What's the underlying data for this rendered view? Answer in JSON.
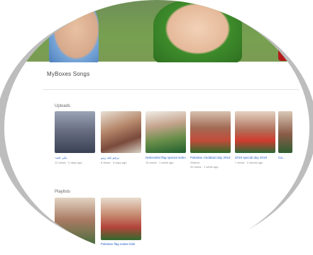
{
  "channel": {
    "name": "MyBoxes Songs"
  },
  "sections": [
    {
      "title": "Uploads",
      "videos": [
        {
          "title": "ملی نغمہ",
          "meta": "12 views · 2 days ago"
        },
        {
          "title": "پرچم بلند رہے",
          "meta": "8 views · 3 days ago"
        },
        {
          "title": "Nationalist flag special video",
          "meta": "15 views · 1 week ago"
        },
        {
          "title": "Pakistan zindabad day 2019",
          "meta": "Shared",
          "meta2": "20 views · 1 week ago"
        },
        {
          "title": "2019 special day 2019",
          "meta": "7 views · 2 weeks ago"
        },
        {
          "title": "Ca...",
          "meta": ""
        }
      ]
    },
    {
      "title": "Playlists",
      "videos": [
        {
          "title": "",
          "meta": ""
        },
        {
          "title": "Pakistan flag salute kids",
          "meta": ""
        }
      ]
    }
  ],
  "colors": {
    "link": "#2a63c7",
    "frame": "#bdbdbd"
  }
}
